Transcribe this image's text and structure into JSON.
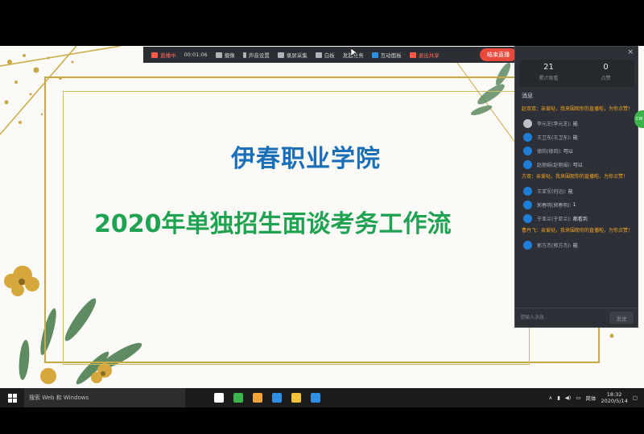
{
  "slide": {
    "title": "伊春职业学院",
    "subtitle": "2020年单独招生面谈考务工作流"
  },
  "toolbar": {
    "live_status": "直播中",
    "timer": "00:01:06",
    "camera": "摄像",
    "audio": "声音设置",
    "capture": "录屏采集",
    "whiteboard": "白板",
    "send_task": "发起任务",
    "interact": "互动面板",
    "exit_share": "退出共享",
    "end_live": "结束直播"
  },
  "chat": {
    "close": "×",
    "stats": [
      {
        "value": "21",
        "label": "累计观看"
      },
      {
        "value": "0",
        "label": "点赞"
      }
    ],
    "header": "消息",
    "messages": [
      {
        "type": "sys",
        "text": "赵双双：亲爱哒，我来围观你的直播啦，为你点赞！"
      },
      {
        "type": "msg",
        "avatar": "gray",
        "name": "李元芝(李元芝):",
        "text": "能"
      },
      {
        "type": "msg",
        "avatar": "blue",
        "name": "王卫东(王卫东):",
        "text": "能"
      },
      {
        "type": "msg",
        "avatar": "blue",
        "name": "德岗(德岗):",
        "text": "可以"
      },
      {
        "type": "msg",
        "avatar": "blue",
        "name": "赵丽娟(赵丽娟):",
        "text": "可以"
      },
      {
        "type": "sys",
        "text": "方双：亲爱哒，我来围观你的直播啦，为你点赞！"
      },
      {
        "type": "msg",
        "avatar": "blue",
        "name": "王亚军(何迅):",
        "text": "能"
      },
      {
        "type": "msg",
        "avatar": "blue",
        "name": "郭春明(郭春明):",
        "text": "1"
      },
      {
        "type": "msg",
        "avatar": "blue",
        "name": "于亚兰(于亚兰):",
        "text": "都看到"
      },
      {
        "type": "sys",
        "text": "曹丹飞：亲爱哒，我来围观你的直播啦，为你点赞！"
      },
      {
        "type": "msg",
        "avatar": "blue",
        "name": "郭方杰(郭方杰):",
        "text": "能"
      }
    ],
    "input_placeholder": "请输入消息",
    "send": "发送",
    "side_badge": "CW"
  },
  "taskbar": {
    "search_placeholder": "搜索 Web 和 Windows",
    "lang": "简体",
    "time": "18:32",
    "date": "2020/5/14",
    "pinned": [
      {
        "name": "task-view-icon",
        "color": "#ffffff"
      },
      {
        "name": "browser-icon",
        "color": "#3cb44a"
      },
      {
        "name": "app-icon-1",
        "color": "#f2a33a"
      },
      {
        "name": "app-icon-2",
        "color": "#2f8fe0"
      },
      {
        "name": "app-icon-3",
        "color": "#f2c23a"
      },
      {
        "name": "app-icon-4",
        "color": "#2f8fe0"
      }
    ]
  }
}
